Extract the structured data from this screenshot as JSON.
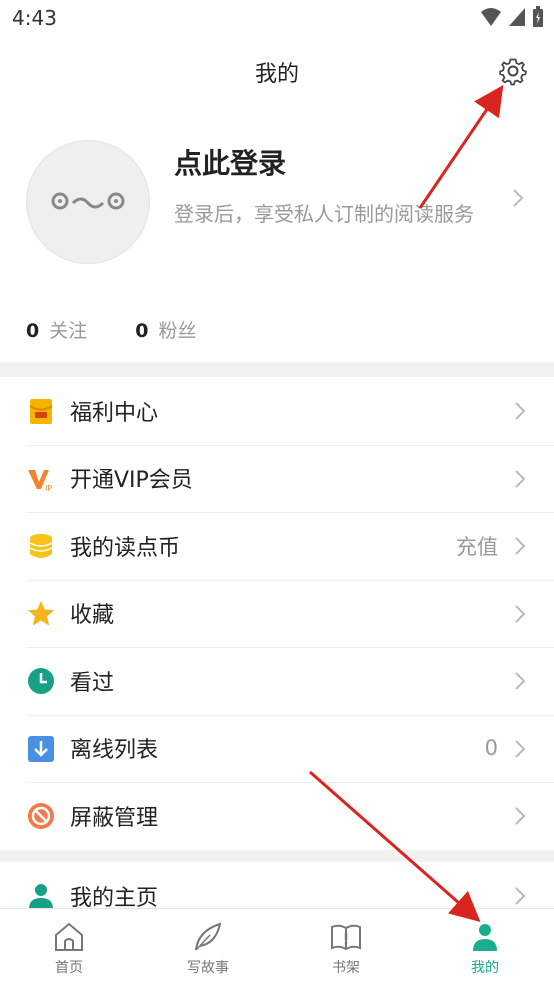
{
  "status_bar": {
    "time": "4:43"
  },
  "header": {
    "title": "我的",
    "settings_icon": "gear-icon"
  },
  "profile": {
    "avatar_face": "⊙‿⊙",
    "login_title": "点此登录",
    "login_desc": "登录后，享受私人订制的阅读服务",
    "stats": [
      {
        "count": "0",
        "label": "关注"
      },
      {
        "count": "0",
        "label": "粉丝"
      }
    ]
  },
  "menu": {
    "items": [
      {
        "label": "福利中心",
        "icon": "gift-envelope-icon",
        "extra": ""
      },
      {
        "label": "开通VIP会员",
        "icon": "vip-icon",
        "extra": ""
      },
      {
        "label": "我的读点币",
        "icon": "coins-icon",
        "extra": "充值"
      },
      {
        "label": "收藏",
        "icon": "star-icon",
        "extra": ""
      },
      {
        "label": "看过",
        "icon": "clock-icon",
        "extra": ""
      },
      {
        "label": "离线列表",
        "icon": "download-icon",
        "extra": "0"
      },
      {
        "label": "屏蔽管理",
        "icon": "block-icon",
        "extra": ""
      }
    ],
    "homepage_label": "我的主页"
  },
  "tabbar": {
    "tabs": [
      {
        "label": "首页",
        "icon": "home-icon"
      },
      {
        "label": "写故事",
        "icon": "feather-icon"
      },
      {
        "label": "书架",
        "icon": "book-icon"
      },
      {
        "label": "我的",
        "icon": "person-icon"
      }
    ],
    "active_color": "#1aae8e"
  },
  "colors": {
    "accent": "#1aae8e",
    "annotation_arrow": "#d9251d"
  }
}
